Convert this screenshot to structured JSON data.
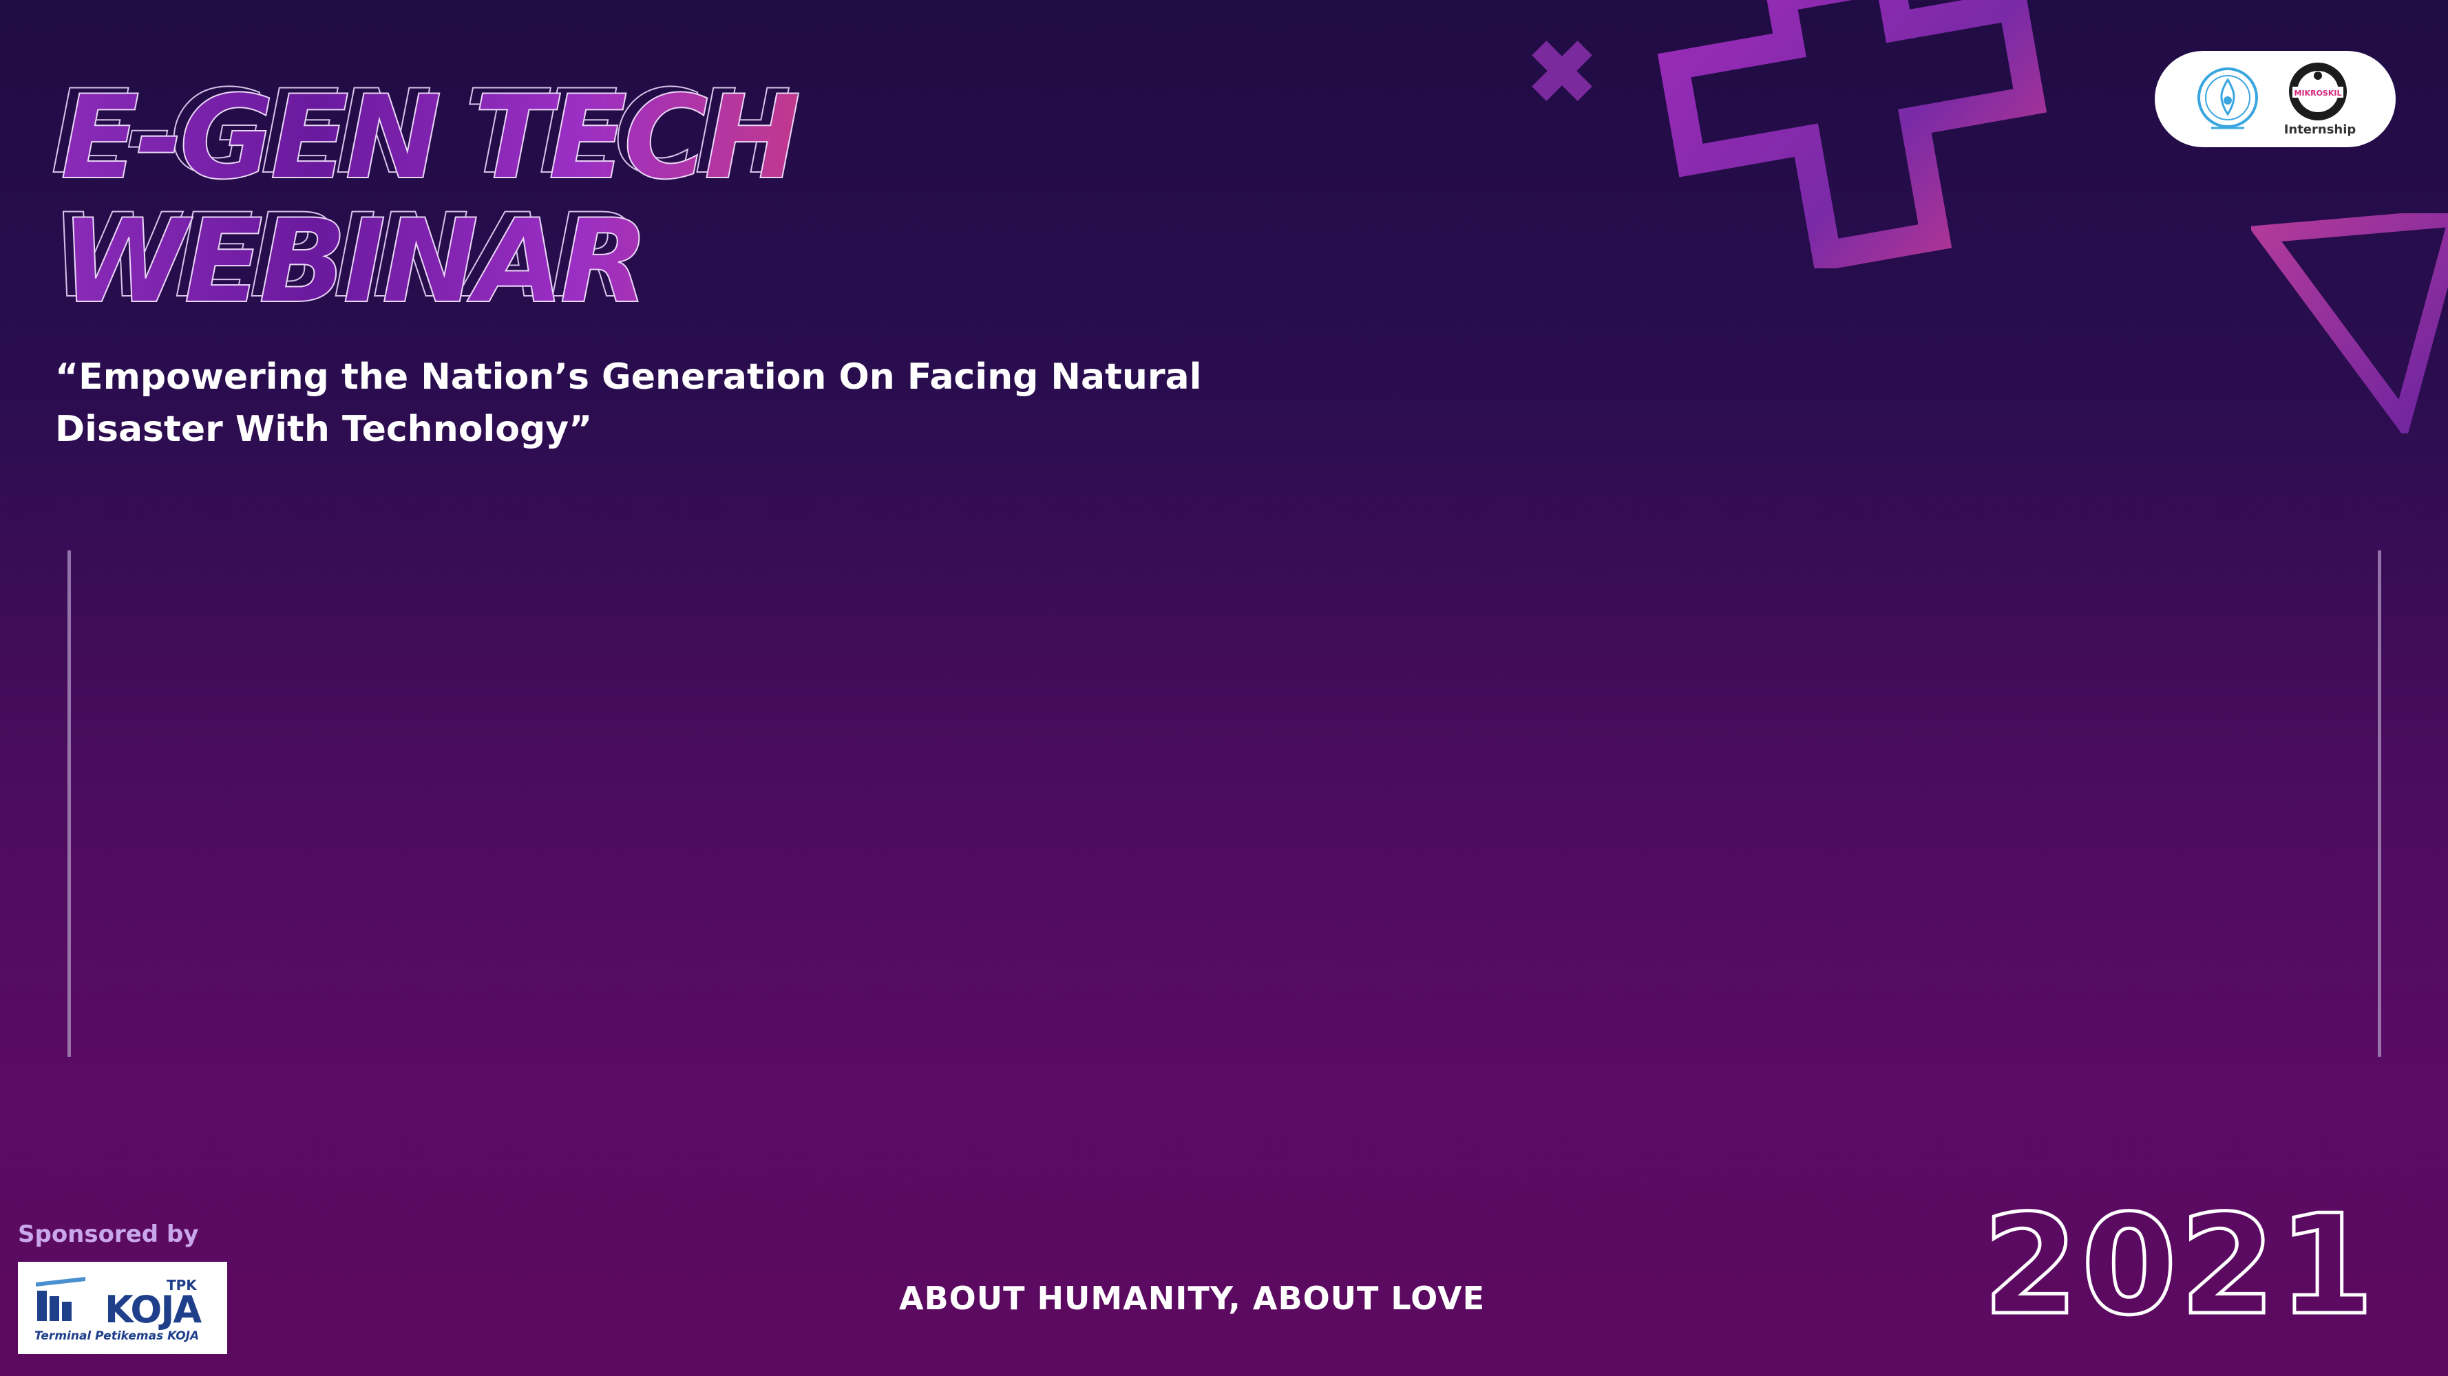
{
  "header": {
    "title_line1": "E-GEN TECH",
    "title_line2": "WEBINAR",
    "tagline_line1": "“Empowering the Nation’s Generation On Facing Natural",
    "tagline_line2": "Disaster With Technology”"
  },
  "logos": {
    "internship_label": "Internship",
    "mikroskil_text": "MIKROSKIL"
  },
  "footer": {
    "sponsored_label": "Sponsored by",
    "sponsor": {
      "short": "TPK",
      "name": "KOJA",
      "full_name": "Terminal Petikemas KOJA"
    },
    "slogan": "ABOUT HUMANITY, ABOUT LOVE",
    "year": "2021"
  },
  "colors": {
    "background_top": "#200c44",
    "background_bottom": "#5c0a60",
    "accent_purple": "#8a2bb8",
    "accent_pink": "#c0398e",
    "sponsor_blue": "#1f3f8a",
    "sponsored_label": "#c9a7ec"
  },
  "icons": [
    "university-logo-icon",
    "mikroskil-logo-icon",
    "koja-logo-icon",
    "cross-shape-icon",
    "triangle-shape-icon"
  ]
}
